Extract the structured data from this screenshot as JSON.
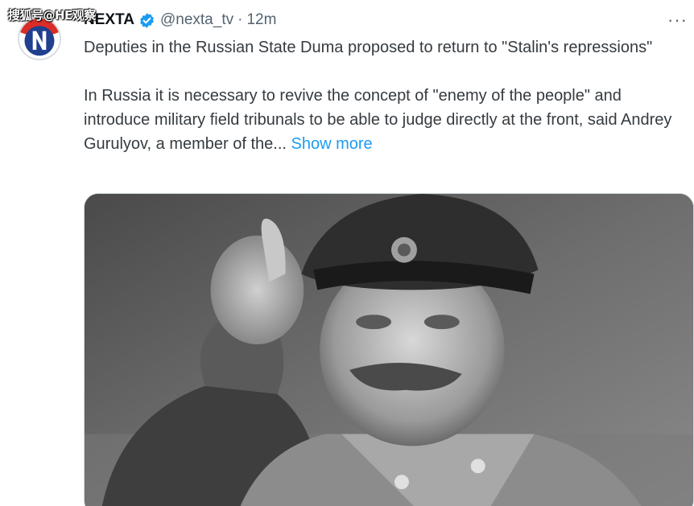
{
  "watermark": "搜狐号@HE观察",
  "tweet": {
    "display_name": "NEXTA",
    "handle": "@nexta_tv",
    "separator": "·",
    "timestamp": "12m",
    "more_icon": "more-horizontal-icon",
    "text_paragraph_1": "Deputies in the Russian State Duma proposed to return to \"Stalin's repressions\"",
    "text_paragraph_2": "In Russia it is necessary to revive the concept of \"enemy of the people\" and introduce military field tribunals to be able to judge directly at the front, said Andrey Gurulyov, a member of the...",
    "show_more_label": "Show more",
    "avatar_letter": "N",
    "media": "photo-grayscale"
  },
  "colors": {
    "link": "#1d9bf0",
    "verified": "#1d9bf0",
    "avatar_red": "#d92d27",
    "avatar_blue": "#1f3f8f",
    "muted_text": "#536471"
  }
}
